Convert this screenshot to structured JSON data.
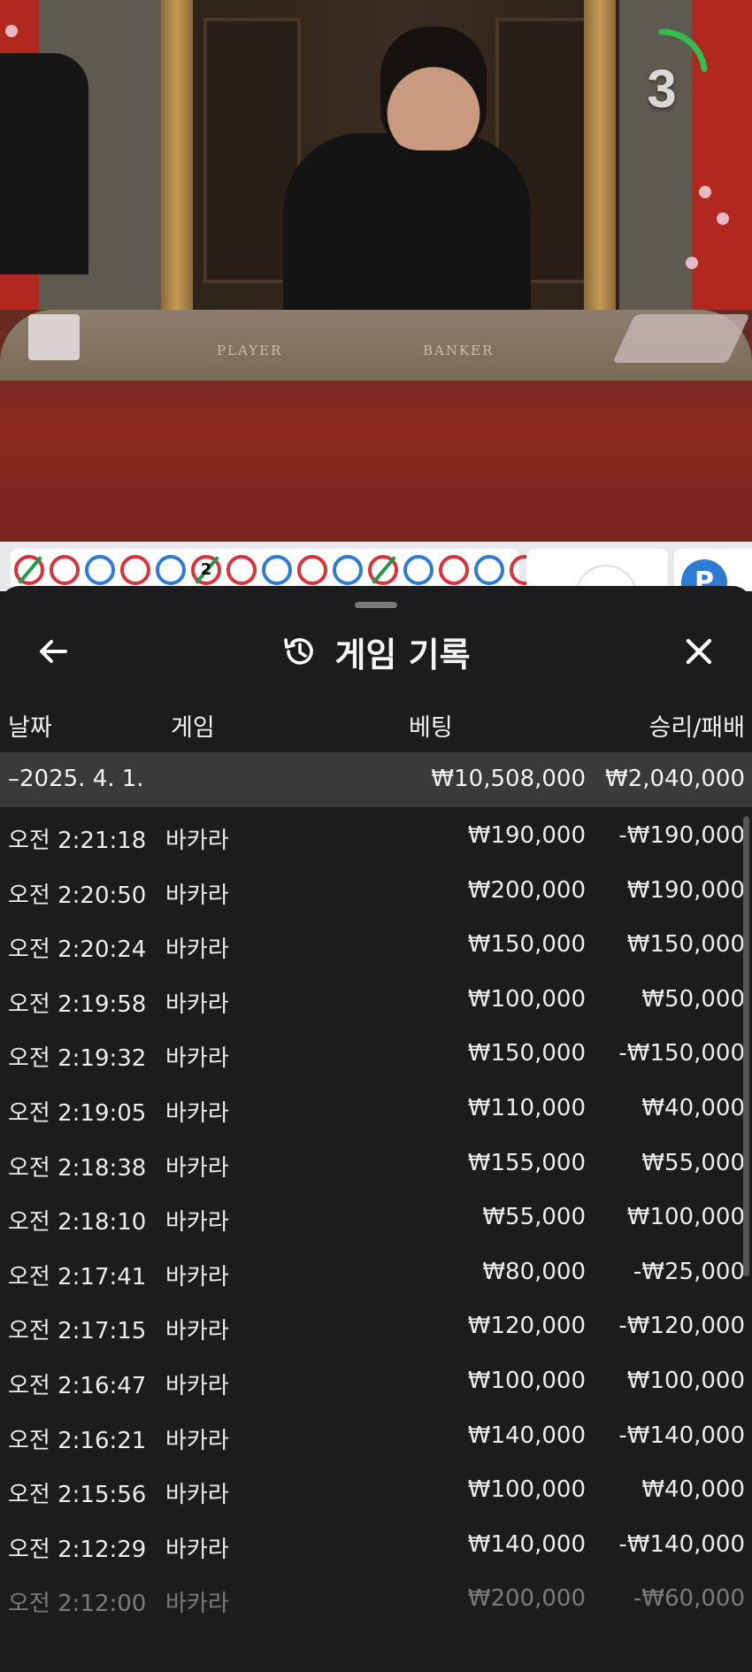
{
  "video": {
    "table_player_label": "PLAYER",
    "table_banker_label": "BANKER",
    "countdown": "3"
  },
  "road": {
    "beads": [
      {
        "color": "banker",
        "slash": true
      },
      {
        "color": "banker"
      },
      {
        "color": "player"
      },
      {
        "color": "banker"
      },
      {
        "color": "player"
      },
      {
        "color": "banker",
        "slash": true,
        "count": "2"
      },
      {
        "color": "banker"
      },
      {
        "color": "player"
      },
      {
        "color": "banker"
      },
      {
        "color": "player"
      },
      {
        "color": "banker",
        "slash": true
      },
      {
        "color": "player"
      },
      {
        "color": "banker"
      },
      {
        "color": "player"
      },
      {
        "color": "banker"
      }
    ],
    "right_badge": "P"
  },
  "sheet": {
    "title": "게임 기록",
    "back_icon": "arrow-left-icon",
    "history_icon": "history-icon",
    "close_icon": "close-icon",
    "columns": {
      "date": "날짜",
      "game": "게임",
      "bet": "베팅",
      "win_loss": "승리/패배"
    },
    "date_group": {
      "date": "–2025. 4. 1.",
      "bet": "₩10,508,000",
      "win_loss": "₩2,040,000"
    },
    "rows": [
      {
        "time": "오전 2:21:18",
        "game": "바카라",
        "bet": "₩190,000",
        "win_loss": "-₩190,000"
      },
      {
        "time": "오전 2:20:50",
        "game": "바카라",
        "bet": "₩200,000",
        "win_loss": "₩190,000"
      },
      {
        "time": "오전 2:20:24",
        "game": "바카라",
        "bet": "₩150,000",
        "win_loss": "₩150,000"
      },
      {
        "time": "오전 2:19:58",
        "game": "바카라",
        "bet": "₩100,000",
        "win_loss": "₩50,000"
      },
      {
        "time": "오전 2:19:32",
        "game": "바카라",
        "bet": "₩150,000",
        "win_loss": "-₩150,000"
      },
      {
        "time": "오전 2:19:05",
        "game": "바카라",
        "bet": "₩110,000",
        "win_loss": "₩40,000"
      },
      {
        "time": "오전 2:18:38",
        "game": "바카라",
        "bet": "₩155,000",
        "win_loss": "₩55,000"
      },
      {
        "time": "오전 2:18:10",
        "game": "바카라",
        "bet": "₩55,000",
        "win_loss": "₩100,000"
      },
      {
        "time": "오전 2:17:41",
        "game": "바카라",
        "bet": "₩80,000",
        "win_loss": "-₩25,000"
      },
      {
        "time": "오전 2:17:15",
        "game": "바카라",
        "bet": "₩120,000",
        "win_loss": "-₩120,000"
      },
      {
        "time": "오전 2:16:47",
        "game": "바카라",
        "bet": "₩100,000",
        "win_loss": "₩100,000"
      },
      {
        "time": "오전 2:16:21",
        "game": "바카라",
        "bet": "₩140,000",
        "win_loss": "-₩140,000"
      },
      {
        "time": "오전 2:15:56",
        "game": "바카라",
        "bet": "₩100,000",
        "win_loss": "₩40,000"
      },
      {
        "time": "오전 2:12:29",
        "game": "바카라",
        "bet": "₩140,000",
        "win_loss": "-₩140,000"
      },
      {
        "time": "오전 2:12:00",
        "game": "바카라",
        "bet": "₩200,000",
        "win_loss": "-₩60,000"
      }
    ]
  },
  "colors": {
    "sheet_bg": "#1c1c1e",
    "date_row_bg": "#3a3a3c",
    "banker_red": "#d9323a",
    "player_blue": "#2f7bd4",
    "tie_green": "#1f9a4a"
  }
}
